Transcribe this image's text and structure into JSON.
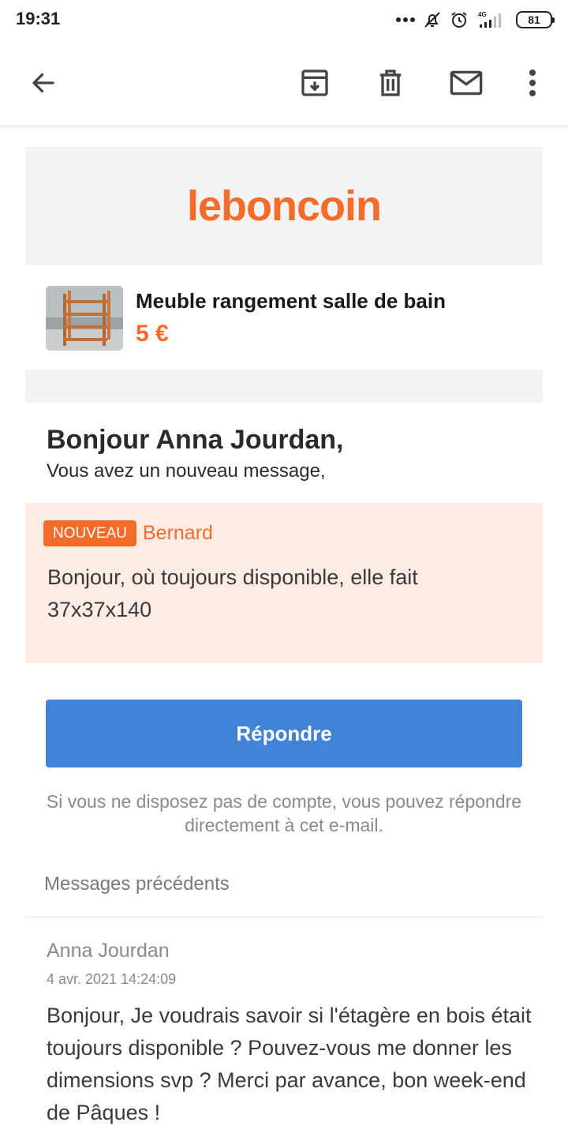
{
  "status_bar": {
    "time": "19:31",
    "network": "4G",
    "battery": "81",
    "icons": [
      "more-dots-icon",
      "notifications-off-icon",
      "alarm-icon",
      "signal-icon",
      "battery-icon"
    ]
  },
  "app_bar": {
    "icons": [
      "back-arrow-icon",
      "archive-icon",
      "delete-icon",
      "mail-icon",
      "more-vert-icon"
    ]
  },
  "email": {
    "brand": "leboncoin",
    "brand_color": "#f56b2a",
    "ad": {
      "title": "Meuble rangement salle de bain",
      "price": "5 €"
    },
    "greeting": {
      "title": "Bonjour Anna Jourdan,",
      "subtitle": "Vous avez un nouveau message,"
    },
    "new_message": {
      "badge": "NOUVEAU",
      "sender": "Bernard",
      "text": "Bonjour, où toujours disponible, elle fait 37x37x140"
    },
    "reply_button": "Répondre",
    "reply_color": "#4183d7",
    "hint": "Si vous ne disposez pas de compte, vous pouvez répondre directement à cet e-mail.",
    "previous": {
      "title": "Messages précédents",
      "items": [
        {
          "author": "Anna Jourdan",
          "date": "4 avr. 2021 14:24:09",
          "text": "Bonjour, Je voudrais savoir si l'étagère en bois était toujours disponible ? Pouvez-vous me donner les dimensions svp ? Merci par avance, bon week-end de Pâques !"
        }
      ]
    }
  }
}
